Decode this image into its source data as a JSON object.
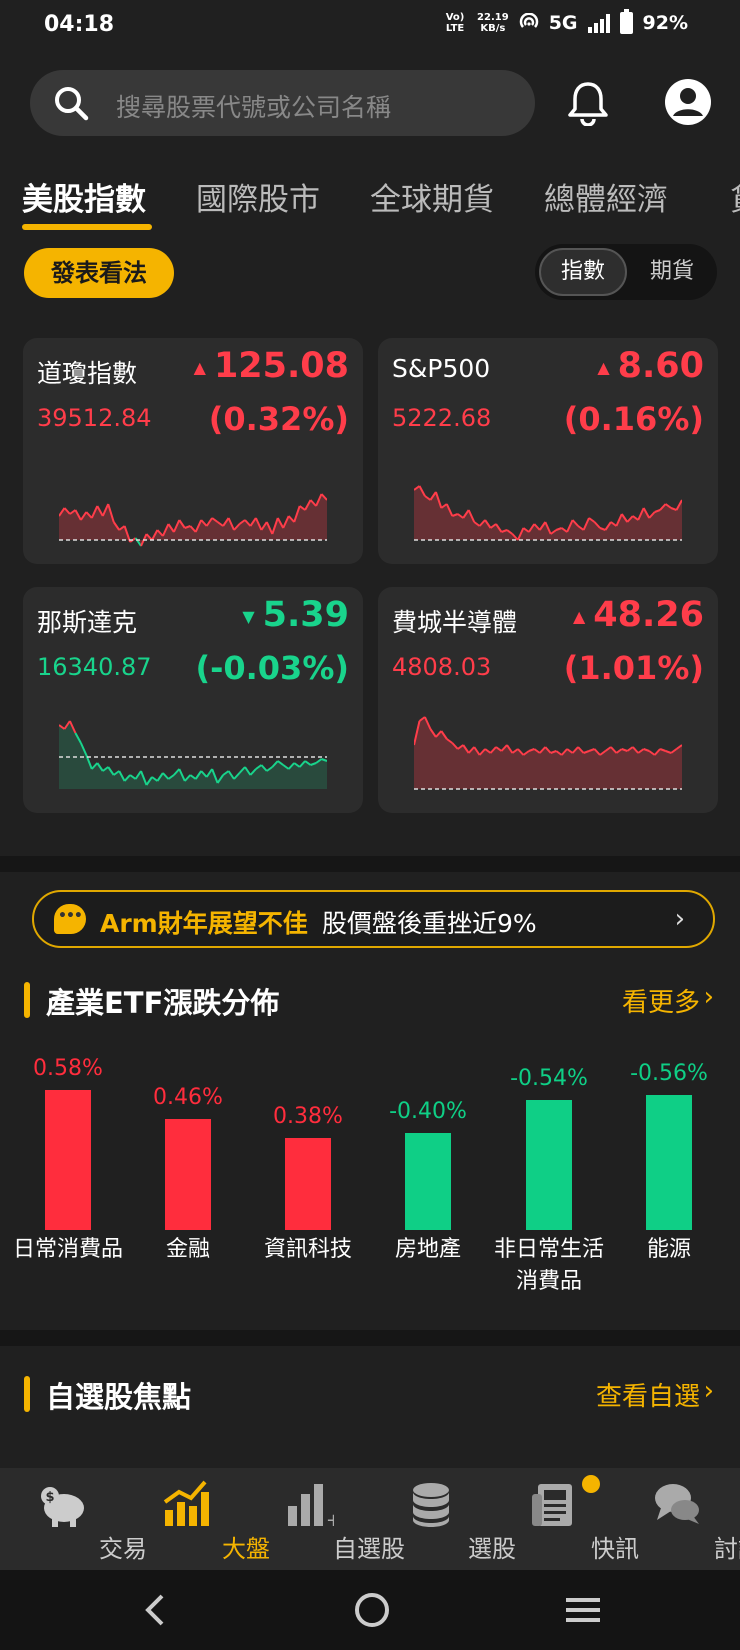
{
  "status": {
    "time": "04:18",
    "volte": "Vo) LTE",
    "speed_value": "22.19",
    "speed_unit": "KB/s",
    "network": "5G",
    "battery": "92%"
  },
  "search": {
    "placeholder": "搜尋股票代號或公司名稱",
    "icon": "search-icon"
  },
  "header_icons": {
    "bell": "bell-icon",
    "account": "account-icon"
  },
  "tabs": [
    {
      "label": "美股指數",
      "active": true
    },
    {
      "label": "國際股市",
      "active": false
    },
    {
      "label": "全球期貨",
      "active": false
    },
    {
      "label": "總體經濟",
      "active": false
    },
    {
      "label": "貨",
      "active": false
    }
  ],
  "post_button": "發表看法",
  "mode_toggle": {
    "index": "指數",
    "futures": "期貨",
    "selected": "指數"
  },
  "indices": [
    {
      "name": "道瓊指數",
      "change": "125.08",
      "price": "39512.84",
      "pct": "(0.32%)",
      "direction": "up",
      "spark": [
        56,
        48,
        54,
        50,
        60,
        52,
        58,
        46,
        56,
        44,
        62,
        70,
        66,
        82,
        78,
        86,
        74,
        80,
        70,
        76,
        64,
        72,
        60,
        68,
        66,
        72,
        60,
        66,
        58,
        62,
        66,
        58,
        70,
        64,
        60,
        66,
        58,
        70,
        62,
        74,
        58,
        68,
        56,
        62,
        46,
        50,
        40,
        46,
        34,
        40
      ]
    },
    {
      "name": "S&P500",
      "change": "8.60",
      "price": "5222.68",
      "pct": "(0.16%)",
      "direction": "up",
      "spark": [
        30,
        26,
        36,
        40,
        32,
        48,
        44,
        56,
        54,
        58,
        50,
        62,
        66,
        60,
        68,
        64,
        72,
        70,
        74,
        80,
        68,
        72,
        64,
        70,
        62,
        74,
        70,
        68,
        72,
        60,
        66,
        70,
        58,
        62,
        68,
        70,
        62,
        66,
        54,
        62,
        56,
        60,
        48,
        58,
        52,
        50,
        44,
        48,
        50,
        40
      ]
    },
    {
      "name": "那斯達克",
      "change": "5.39",
      "price": "16340.87",
      "pct": "(-0.03%)",
      "direction": "down",
      "spark": [
        16,
        20,
        12,
        24,
        34,
        46,
        60,
        54,
        62,
        58,
        66,
        62,
        72,
        66,
        70,
        62,
        76,
        68,
        72,
        64,
        70,
        66,
        60,
        72,
        66,
        70,
        62,
        68,
        60,
        74,
        66,
        62,
        70,
        64,
        58,
        66,
        60,
        56,
        62,
        58,
        52,
        56,
        60,
        54,
        58,
        52,
        56,
        54,
        50,
        52
      ]
    },
    {
      "name": "費城半導體",
      "change": "48.26",
      "price": "4808.03",
      "pct": "(1.01%)",
      "direction": "up",
      "spark": [
        36,
        12,
        8,
        20,
        28,
        22,
        30,
        34,
        40,
        36,
        44,
        38,
        46,
        40,
        44,
        38,
        42,
        36,
        44,
        40,
        46,
        42,
        40,
        44,
        38,
        44,
        42,
        46,
        40,
        44,
        38,
        44,
        42,
        40,
        46,
        42,
        38,
        44,
        40,
        42,
        38,
        44,
        40,
        42,
        46,
        40,
        42,
        44,
        40,
        36
      ]
    }
  ],
  "news": {
    "highlight": "Arm財年展望不佳",
    "text": "股價盤後重挫近9%",
    "chevron": "›"
  },
  "etf_section": {
    "title": "產業ETF漲跌分佈",
    "more": "看更多"
  },
  "chart_data": {
    "type": "bar",
    "title": "產業ETF漲跌分佈",
    "categories": [
      "日常消費品",
      "金融",
      "資訊科技",
      "房地產",
      "非日常生活消費品",
      "能源"
    ],
    "category_lines": [
      [
        "日常消費品"
      ],
      [
        "金融"
      ],
      [
        "資訊科技"
      ],
      [
        "房地產"
      ],
      [
        "非日常生活",
        "消費品"
      ],
      [
        "能源"
      ]
    ],
    "values": [
      0.58,
      0.46,
      0.38,
      -0.4,
      -0.54,
      -0.56
    ],
    "labels": [
      "0.58%",
      "0.46%",
      "0.38%",
      "-0.40%",
      "-0.54%",
      "-0.56%"
    ],
    "colors": {
      "positive": "#ff2d3d",
      "negative": "#0fcf86"
    }
  },
  "watch_section": {
    "title": "自選股焦點",
    "more": "查看自選"
  },
  "bottom_nav": [
    {
      "label": "交易",
      "icon": "piggy-bank-icon",
      "active": false
    },
    {
      "label": "大盤",
      "icon": "bar-chart-icon",
      "active": true
    },
    {
      "label": "自選股",
      "icon": "watchlist-icon",
      "active": false
    },
    {
      "label": "選股",
      "icon": "database-icon",
      "active": false
    },
    {
      "label": "快訊",
      "icon": "newspaper-icon",
      "active": false
    },
    {
      "label": "討論",
      "icon": "chat-icon",
      "active": false
    }
  ],
  "colors": {
    "accent": "#f5b400",
    "up": "#ff3d4a",
    "down": "#19d48c",
    "background": "#202020",
    "card": "#2c2c2c"
  }
}
